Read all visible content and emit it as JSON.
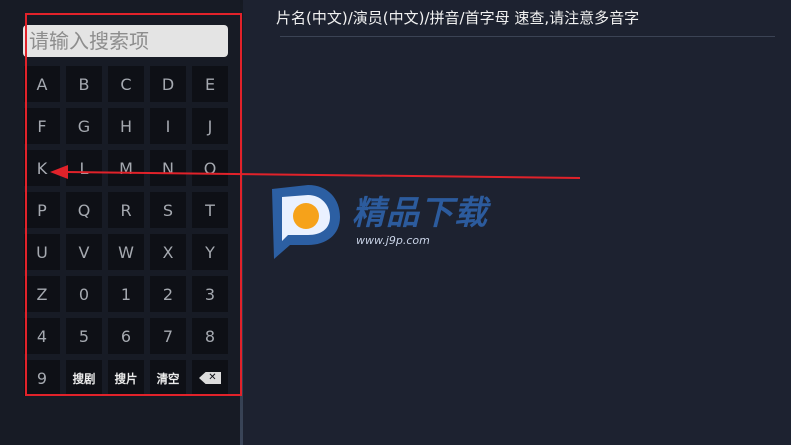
{
  "search": {
    "placeholder": "请输入搜索项"
  },
  "keyboard": {
    "rows": [
      [
        "A",
        "B",
        "C",
        "D",
        "E"
      ],
      [
        "F",
        "G",
        "H",
        "I",
        "J"
      ],
      [
        "K",
        "L",
        "M",
        "N",
        "O"
      ],
      [
        "P",
        "Q",
        "R",
        "S",
        "T"
      ],
      [
        "U",
        "V",
        "W",
        "X",
        "Y"
      ],
      [
        "Z",
        "0",
        "1",
        "2",
        "3"
      ],
      [
        "4",
        "5",
        "6",
        "7",
        "8"
      ]
    ],
    "last_row": {
      "digit": "9",
      "search_series": "搜剧",
      "search_movie": "搜片",
      "clear": "清空",
      "delete_icon": "backspace-icon",
      "delete_glyph": "✕"
    }
  },
  "hint": {
    "text": "片名(中文)/演员(中文)/拼音/首字母 速查,请注意多音字"
  },
  "watermark": {
    "title": "精品下载",
    "url": "www.j9p.com"
  },
  "colors": {
    "background": "#1d2230",
    "panel": "#171b25",
    "key": "#0e1016",
    "annotation": "#e1222a",
    "watermark_blue": "#2f66b0",
    "watermark_orange": "#f6a21a"
  }
}
